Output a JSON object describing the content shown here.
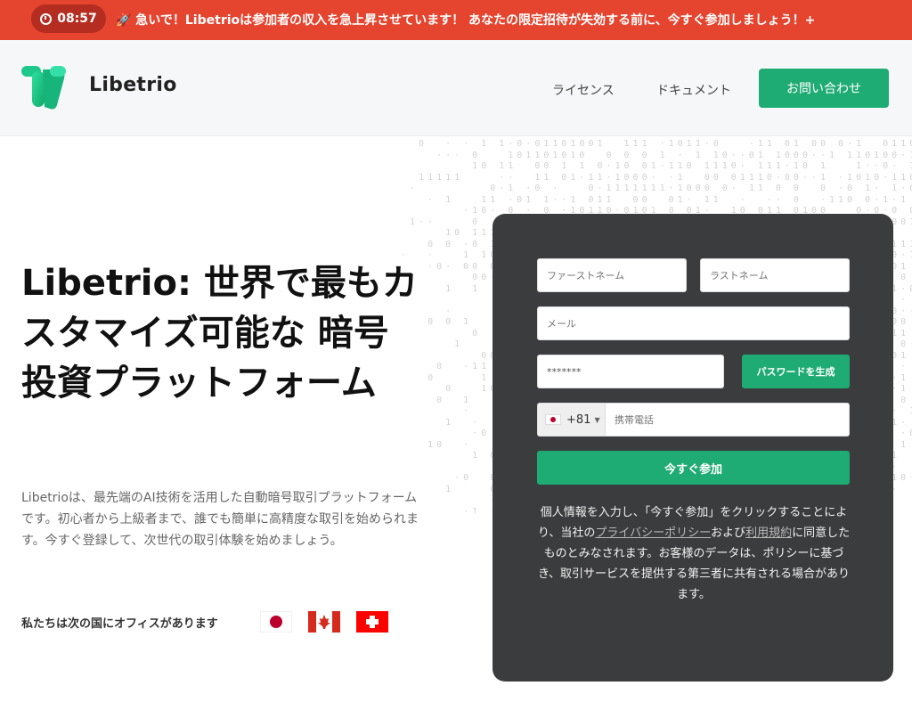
{
  "banner": {
    "timer": "08:57",
    "message": "🚀 急いで！Libetrioは参加者の収入を急上昇させています！ あなたの限定招待が失効する前に、今すぐ参加しましょう！+"
  },
  "header": {
    "logo_text": "Libetrio",
    "nav": [
      "ライセンス",
      "ドキュメント"
    ],
    "contact_label": "お問い合わせ"
  },
  "hero": {
    "title": "Libetrio: 世界で最もカスタマイズ可能な 暗号投資プラットフォーム",
    "description": "Libetrioは、最先端のAI技術を活用した自動暗号取引プラットフォームです。初心者から上級者まで、誰でも簡単に高精度な取引を始められます。今すぐ登録して、次世代の取引体験を始めましょう。",
    "offices_label": "私たちは次の国にオフィスがあります",
    "flags": [
      "japan-flag",
      "canada-flag",
      "switzerland-flag"
    ]
  },
  "form": {
    "first_name_placeholder": "ファーストネーム",
    "last_name_placeholder": "ラストネーム",
    "email_placeholder": "メール",
    "password_value": "*******",
    "generate_label": "パスワードを生成",
    "dial_code": "+81",
    "phone_placeholder": "携帯電話",
    "join_label": "今すぐ参加",
    "consent_before": "個人情報を入力し、「今すぐ参加」をクリックすることにより、当社の",
    "privacy_link": "プライバシーポリシー",
    "consent_and": "および",
    "terms_link": "利用規約",
    "consent_after": "に同意したものとみなされます。お客様のデータは、ポリシーに基づき、取引サービスを提供する第三者に共有される場合があります。"
  },
  "colors": {
    "banner": "#e5442f",
    "timer_pill": "#b52d20",
    "accent": "#1fab74",
    "card": "#3b3c3e"
  }
}
